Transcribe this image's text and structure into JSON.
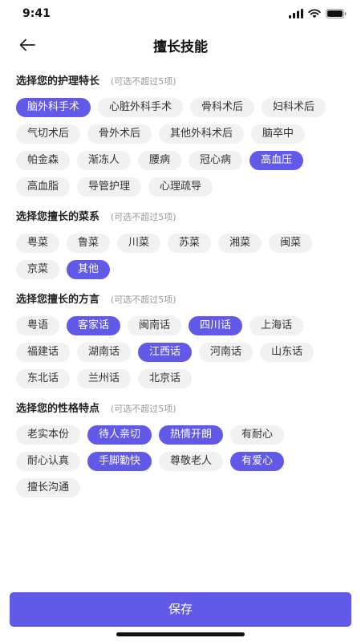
{
  "status": {
    "time": "9:41"
  },
  "header": {
    "title": "擅长技能"
  },
  "sections": [
    {
      "title": "选择您的护理特长",
      "hint": "(可选不超过5项)",
      "tags": [
        {
          "label": "脑外科手术",
          "selected": true
        },
        {
          "label": "心脏外科手术",
          "selected": false
        },
        {
          "label": "骨科术后",
          "selected": false
        },
        {
          "label": "妇科术后",
          "selected": false
        },
        {
          "label": "气切术后",
          "selected": false
        },
        {
          "label": "骨外术后",
          "selected": false
        },
        {
          "label": "其他外科术后",
          "selected": false
        },
        {
          "label": "脑卒中",
          "selected": false
        },
        {
          "label": "帕金森",
          "selected": false
        },
        {
          "label": "渐冻人",
          "selected": false
        },
        {
          "label": "腰病",
          "selected": false
        },
        {
          "label": "冠心病",
          "selected": false
        },
        {
          "label": "高血压",
          "selected": true
        },
        {
          "label": "高血脂",
          "selected": false
        },
        {
          "label": "导管护理",
          "selected": false
        },
        {
          "label": "心理疏导",
          "selected": false
        }
      ]
    },
    {
      "title": "选择您擅长的菜系",
      "hint": "(可选不超过5项)",
      "tags": [
        {
          "label": "粤菜",
          "selected": false
        },
        {
          "label": "鲁菜",
          "selected": false
        },
        {
          "label": "川菜",
          "selected": false
        },
        {
          "label": "苏菜",
          "selected": false
        },
        {
          "label": "湘菜",
          "selected": false
        },
        {
          "label": "闽菜",
          "selected": false
        },
        {
          "label": "京菜",
          "selected": false
        },
        {
          "label": "其他",
          "selected": true
        }
      ]
    },
    {
      "title": "选择您擅长的方言",
      "hint": "(可选不超过5项)",
      "tags": [
        {
          "label": "粤语",
          "selected": false
        },
        {
          "label": "客家话",
          "selected": true
        },
        {
          "label": "闽南话",
          "selected": false
        },
        {
          "label": "四川话",
          "selected": true
        },
        {
          "label": "上海话",
          "selected": false
        },
        {
          "label": "福建话",
          "selected": false
        },
        {
          "label": "湖南话",
          "selected": false
        },
        {
          "label": "江西话",
          "selected": true
        },
        {
          "label": "河南话",
          "selected": false
        },
        {
          "label": "山东话",
          "selected": false
        },
        {
          "label": "东北话",
          "selected": false
        },
        {
          "label": "兰州话",
          "selected": false
        },
        {
          "label": "北京话",
          "selected": false
        }
      ]
    },
    {
      "title": "选择您的性格特点",
      "hint": "(可选不超过5项)",
      "tags": [
        {
          "label": "老实本份",
          "selected": false
        },
        {
          "label": "待人亲切",
          "selected": true
        },
        {
          "label": "热情开朗",
          "selected": true
        },
        {
          "label": "有耐心",
          "selected": false
        },
        {
          "label": "耐心认真",
          "selected": false
        },
        {
          "label": "手脚勤快",
          "selected": true
        },
        {
          "label": "尊敬老人",
          "selected": false
        },
        {
          "label": "有爱心",
          "selected": true
        },
        {
          "label": "擅长沟通",
          "selected": false
        }
      ]
    }
  ],
  "footer": {
    "save_label": "保存"
  },
  "icons": {
    "back": "arrow-left-icon",
    "signal": "signal-icon",
    "wifi": "wifi-icon",
    "battery": "battery-icon"
  },
  "colors": {
    "accent": "#6159e8",
    "tag_bg": "#f1f1f1"
  }
}
